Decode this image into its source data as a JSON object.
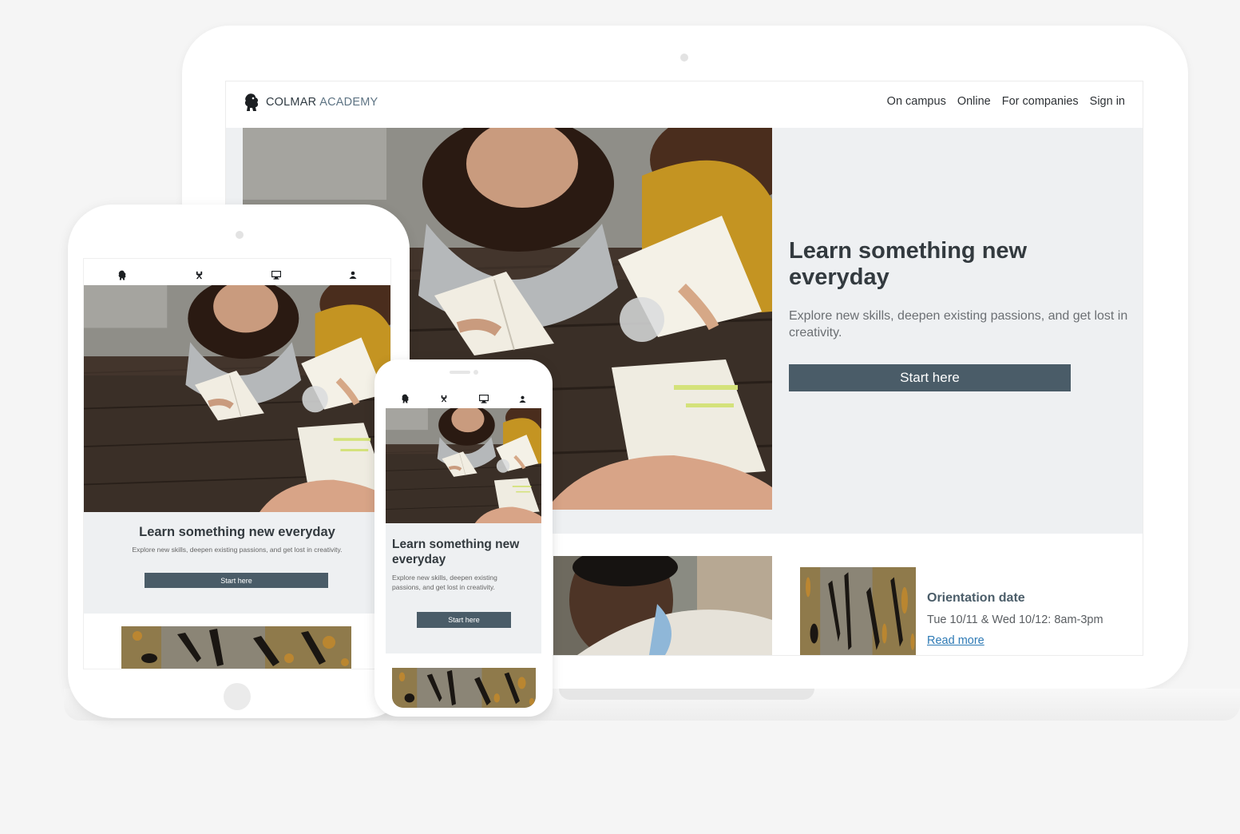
{
  "laptop": {
    "brand": {
      "part1": "COLMAR",
      "part2": "ACADEMY",
      "logo_icon": "lion-logo-icon"
    },
    "nav": {
      "items": [
        "On campus",
        "Online",
        "For companies",
        "Sign in"
      ]
    },
    "hero": {
      "title": "Learn something new everyday",
      "subtitle": "Explore new skills, deepen existing passions, and get lost in creativity.",
      "button": "Start here"
    },
    "orientation": {
      "title": "Orientation date",
      "date": "Tue 10/11 & Wed 10/12: 8am-3pm",
      "link": "Read more"
    }
  },
  "tablet": {
    "icons": [
      "lion-logo-icon",
      "campus-icon",
      "monitor-icon",
      "user-icon"
    ],
    "hero": {
      "title": "Learn something new everyday",
      "subtitle": "Explore new skills, deepen existing passions, and get lost in creativity.",
      "button": "Start here"
    }
  },
  "phone": {
    "icons": [
      "lion-logo-icon",
      "campus-icon",
      "monitor-icon",
      "user-icon"
    ],
    "hero": {
      "title": "Learn something new everyday",
      "subtitle": "Explore new skills, deepen existing passions, and get lost in creativity.",
      "button": "Start here"
    }
  },
  "colors": {
    "accent": "#4a5c68",
    "hero_bg": "#eef0f2",
    "link": "#2e7ab5",
    "brand_secondary": "#5e7484"
  }
}
